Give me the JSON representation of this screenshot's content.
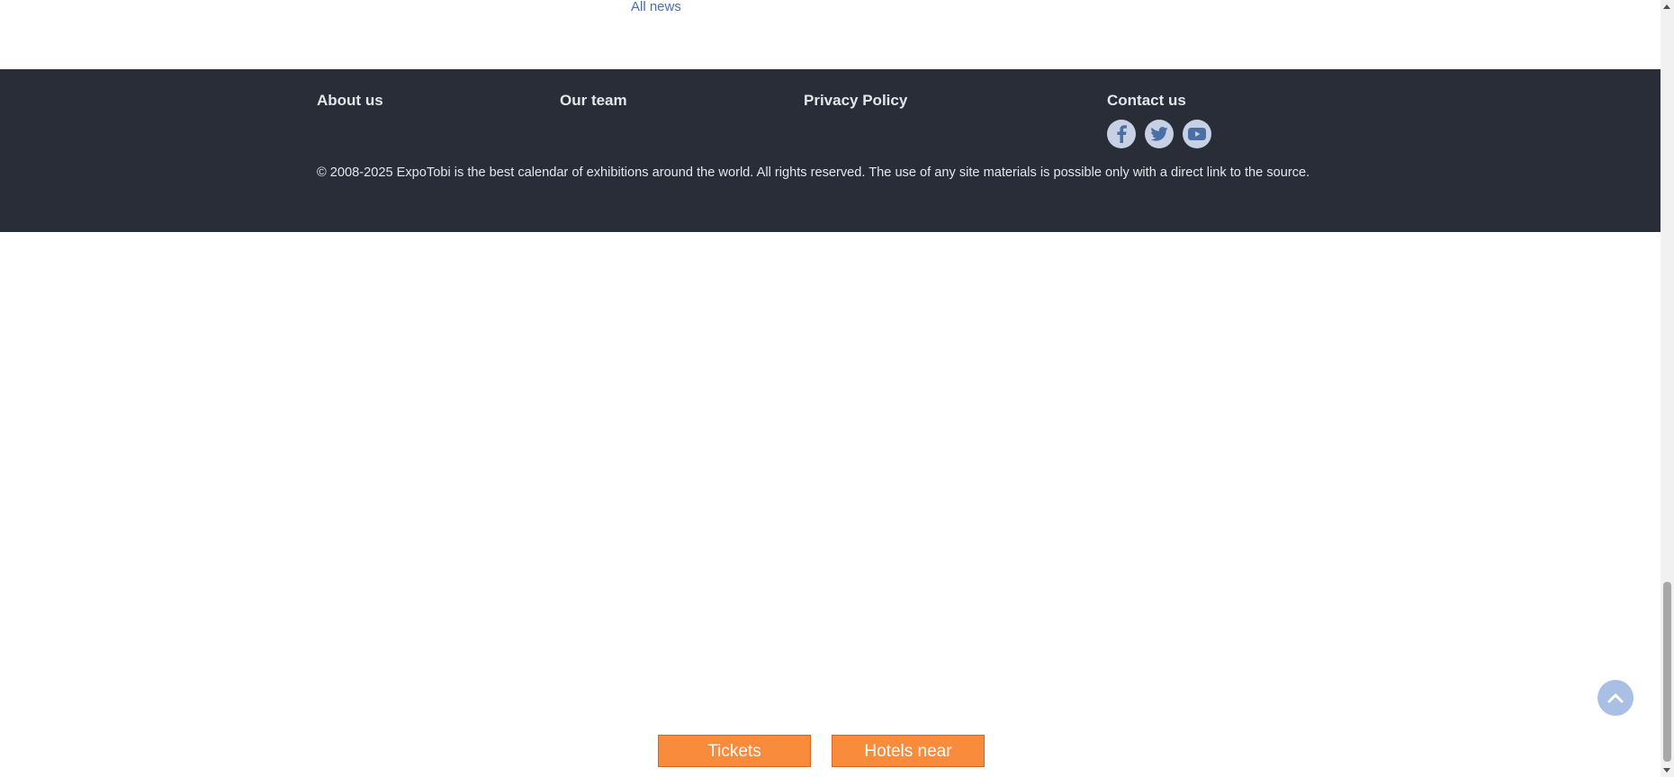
{
  "news": {
    "all_news_label": "All news"
  },
  "footer": {
    "links": {
      "about": "About us",
      "team": "Our team",
      "privacy": "Privacy Policy",
      "contact": "Contact us"
    },
    "social": [
      "facebook-icon",
      "twitter-icon",
      "youtube-icon"
    ],
    "copyright": "© 2008-2025 ExpoTobi is the best calendar of exhibitions around the world. All rights reserved. The use of any site materials is possible only with a direct link to the source."
  },
  "bottom_bar": {
    "tickets_label": "Tickets",
    "hotels_label": "Hotels near"
  },
  "colors": {
    "footer_bg": "#282d37",
    "accent_orange": "#f98b3c",
    "link_blue": "#4a6fa5",
    "social_bg": "#c8d1e3",
    "back_to_top_bg": "#a9bfe4"
  }
}
